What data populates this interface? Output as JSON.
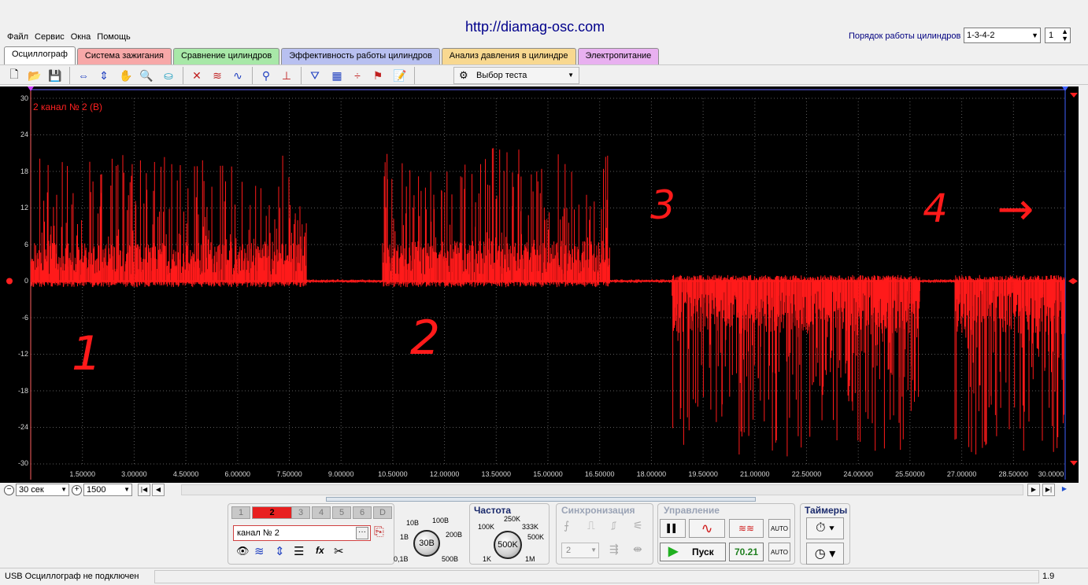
{
  "app": {
    "site_url": "http://diamag-osc.com",
    "menu": [
      "Файл",
      "Сервис",
      "Окна",
      "Помощь"
    ],
    "cylinder_order_label": "Порядок работы цилиндров",
    "cylinder_order_value": "1-3-4-2",
    "cylinder_number": "1"
  },
  "tabs": [
    {
      "label": "Осциллограф",
      "color": "#ffffff",
      "active": true
    },
    {
      "label": "Система зажигания",
      "color": "#f7a8a8"
    },
    {
      "label": "Сравнение цилиндров",
      "color": "#a8e8a8"
    },
    {
      "label": "Эффективность работы цилиндров",
      "color": "#b8c0f0"
    },
    {
      "label": "Анализ давления в цилиндре",
      "color": "#f8d890"
    },
    {
      "label": "Электропитание",
      "color": "#e8b0f0"
    }
  ],
  "toolbar": {
    "test_select": "Выбор теста"
  },
  "scope": {
    "channel_label": "2  канал № 2 (В)",
    "trace_color": "#ff1a1a",
    "y_ticks": [
      "30",
      "24",
      "18",
      "12",
      "6",
      "0",
      "-6",
      "-12",
      "-18",
      "-24",
      "-30"
    ],
    "x_ticks": [
      "1.50000",
      "3.00000",
      "4.50000",
      "6.00000",
      "7.50000",
      "9.00000",
      "10.50000",
      "12.00000",
      "13.50000",
      "15.00000",
      "16.50000",
      "18.00000",
      "19.50000",
      "21.00000",
      "22.50000",
      "24.00000",
      "25.50000",
      "27.00000",
      "28.50000",
      "30.0000"
    ],
    "annotations": [
      "1",
      "2",
      "3",
      "4",
      "→"
    ]
  },
  "chart_data": {
    "type": "line",
    "title": "",
    "xlabel": "",
    "ylabel": "",
    "xlim": [
      0,
      30
    ],
    "ylim": [
      -30,
      30
    ],
    "series": [
      {
        "name": "канал № 2 (В)",
        "segments": [
          {
            "x_range": [
              0,
              8.0
            ],
            "peak_max": 21,
            "peak_min": -1
          },
          {
            "x_range": [
              8.0,
              10.2
            ],
            "peak_max": 0.3,
            "peak_min": -0.3
          },
          {
            "x_range": [
              10.2,
              16.8
            ],
            "peak_max": 22,
            "peak_min": -1
          },
          {
            "x_range": [
              16.8,
              18.6
            ],
            "peak_max": 0.3,
            "peak_min": -0.3
          },
          {
            "x_range": [
              18.6,
              25.8
            ],
            "peak_max": 1,
            "peak_min": -29
          },
          {
            "x_range": [
              25.8,
              26.8
            ],
            "peak_max": 0.3,
            "peak_min": -0.3
          },
          {
            "x_range": [
              26.8,
              30.0
            ],
            "peak_max": 1,
            "peak_min": -29
          }
        ]
      }
    ],
    "grid": true
  },
  "controls": {
    "timebase": "30 сек",
    "points": "1500",
    "channels": [
      "1",
      "2",
      "3",
      "4",
      "5",
      "6",
      "D"
    ],
    "channel_name": "канал № 2",
    "volt_labels": [
      "10В",
      "100В",
      "1В",
      "200В",
      "0,1В",
      "500В"
    ],
    "volt_value": "30В",
    "freq_title": "Частота",
    "freq_labels": [
      "250K",
      "100K",
      "333K",
      "500K",
      "1K",
      "1M"
    ],
    "freq_value": "500K",
    "sync_title": "Синхронизация",
    "sync_channel": "2",
    "control_title": "Управление",
    "start_label": "Пуск",
    "freq_readout": "70.21",
    "timers_title": "Таймеры"
  },
  "status": {
    "text": "USB Осциллограф не подключен",
    "version": "1.9"
  }
}
